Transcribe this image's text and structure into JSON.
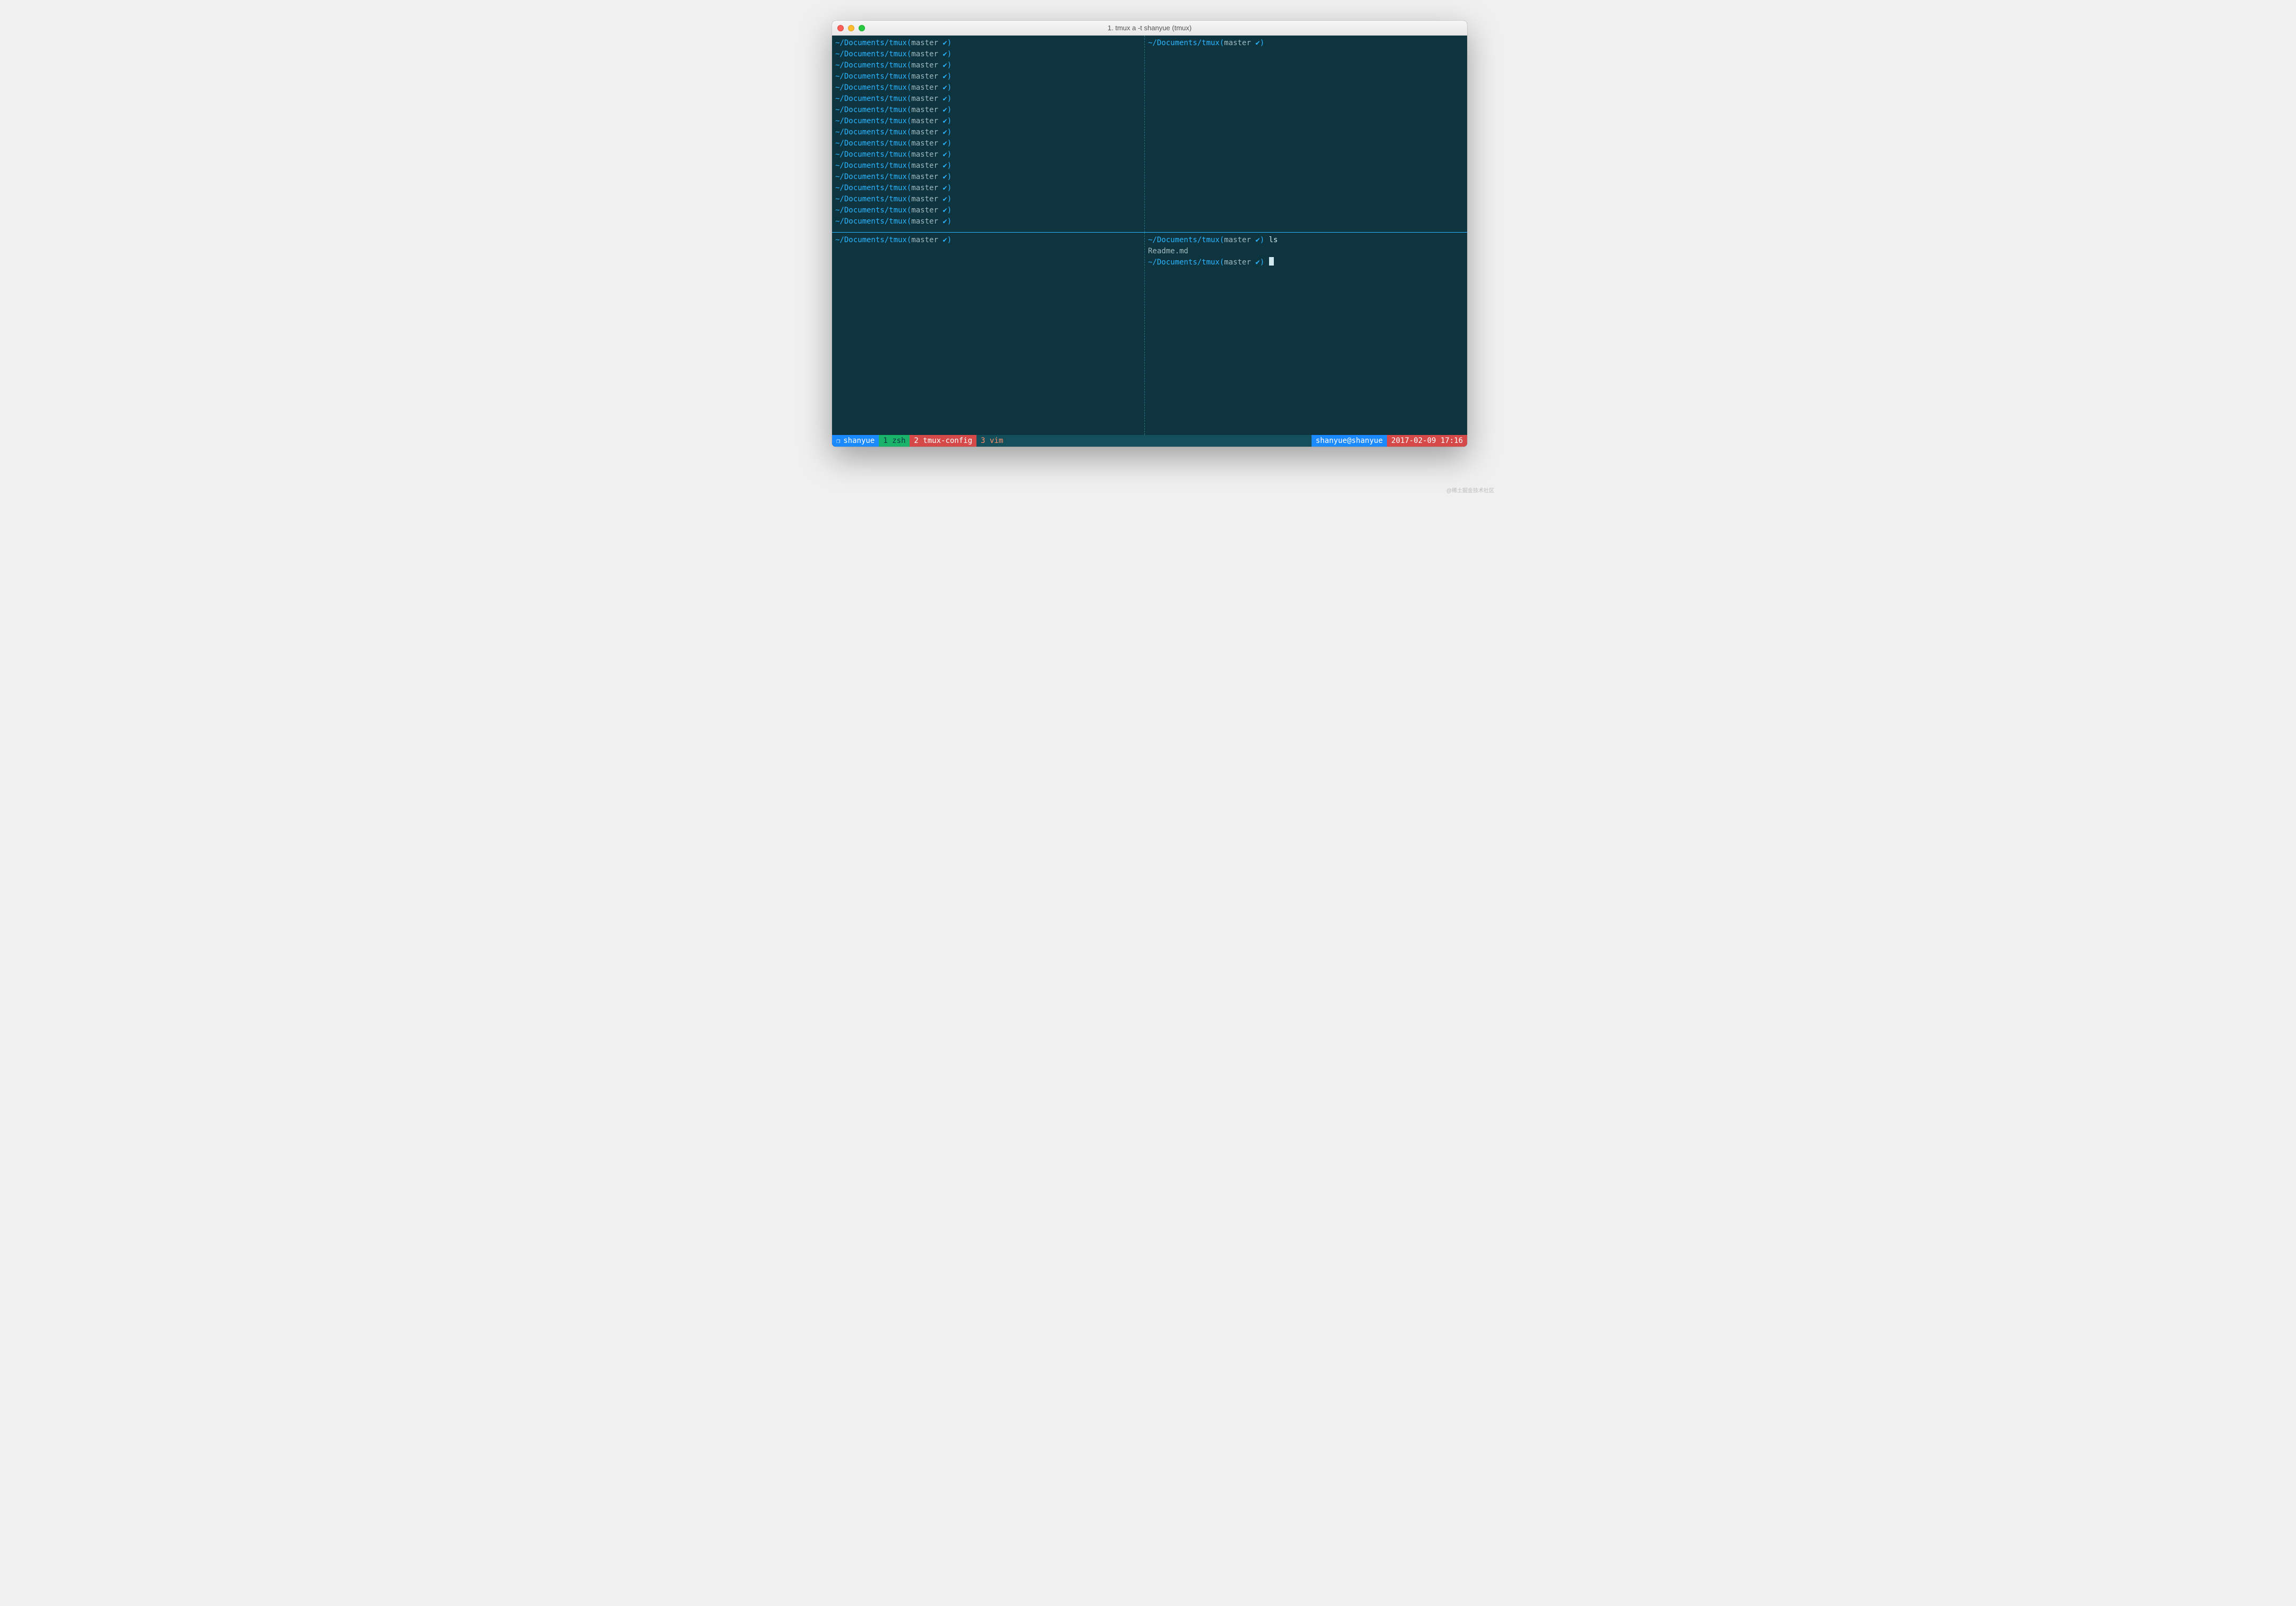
{
  "window": {
    "title": "1. tmux a -t shanyue (tmux)"
  },
  "prompt": {
    "path": "~/Documents/tmux",
    "branch": "master",
    "indicator": "✔"
  },
  "panes": {
    "upper_left": {
      "prompt_repeat": 17
    },
    "upper_right": {
      "prompt_repeat": 1
    },
    "lower_left": {
      "prompt_repeat": 1
    },
    "lower_right": {
      "cmd": "ls",
      "output": "Readme.md"
    }
  },
  "status": {
    "session_icon": "❐",
    "session": "shanyue",
    "windows": [
      {
        "index": "1",
        "name": "zsh"
      },
      {
        "index": "2",
        "name": "tmux-config"
      },
      {
        "index": "3",
        "name": "vim"
      }
    ],
    "user_host": "shanyue@shanyue",
    "datetime": "2017-02-09 17:16"
  },
  "watermark": "@稀土掘金技术社区"
}
